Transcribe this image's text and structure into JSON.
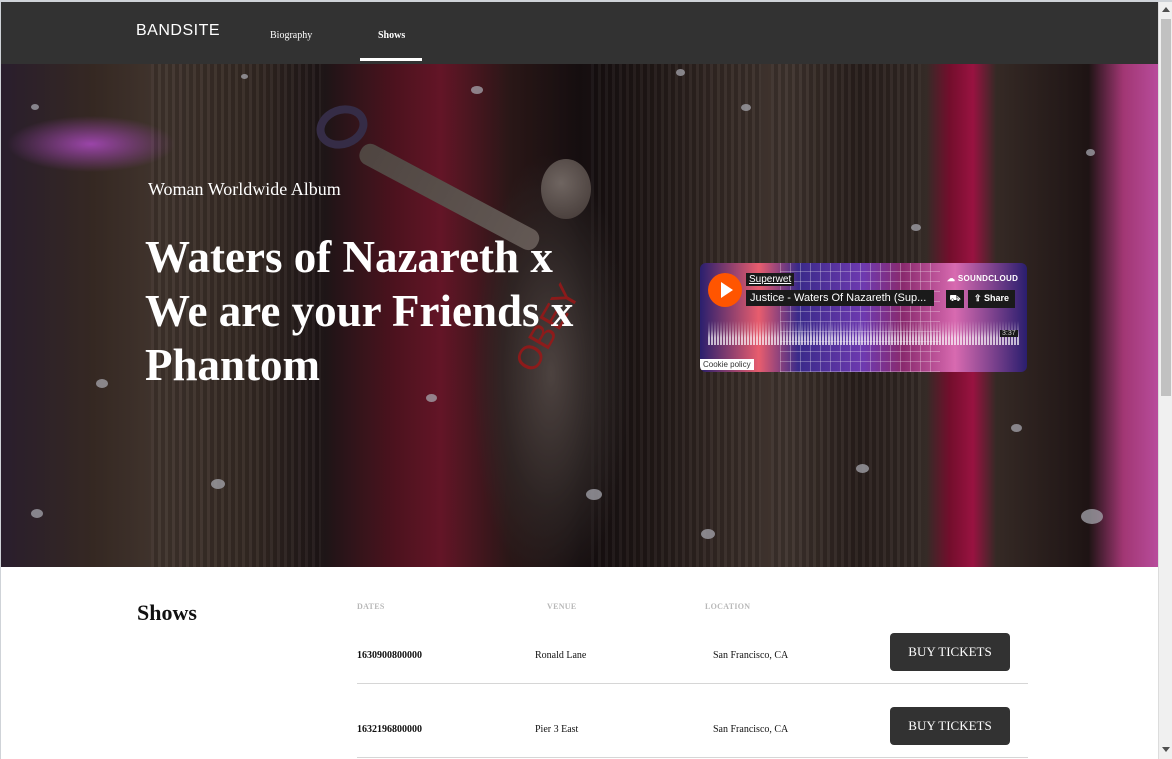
{
  "nav": {
    "logo": "BANDSITE",
    "links": [
      {
        "label": "Biography"
      },
      {
        "label": "Shows"
      }
    ],
    "active": "Shows"
  },
  "hero": {
    "kicker": "Woman Worldwide Album",
    "title": "Waters of Nazareth x We are your Friends x Phantom",
    "graffiti": "OBEY"
  },
  "soundcloud": {
    "artist": "Superwet",
    "track": "Justice - Waters Of Nazareth (Sup...",
    "brand": "SOUNDCLOUD",
    "share_label": "Share",
    "duration": "3:37",
    "cookie_label": "Cookie policy",
    "accent_color": "#ff5500",
    "play_icon": "play-icon",
    "cart_icon": "cart-icon",
    "share_icon": "share-icon"
  },
  "shows": {
    "title": "Shows",
    "columns": [
      "DATES",
      "VENUE",
      "LOCATION"
    ],
    "button_label": "BUY TICKETS",
    "rows": [
      {
        "date": "1630900800000",
        "venue": "Ronald Lane",
        "location": "San Francisco, CA"
      },
      {
        "date": "1632196800000",
        "venue": "Pier 3 East",
        "location": "San Francisco, CA"
      }
    ]
  },
  "colors": {
    "nav_background": "#323232",
    "button_background": "#323232",
    "text_primary": "#111111",
    "column_header": "#b8b8b8"
  }
}
